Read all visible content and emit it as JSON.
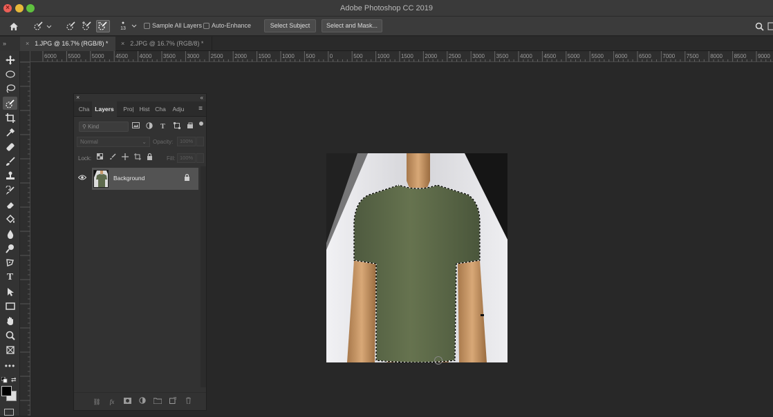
{
  "window": {
    "title": "Adobe Photoshop CC 2019",
    "close_glyph": "×"
  },
  "options_bar": {
    "brush_size": "13",
    "sample_all_layers": "Sample All Layers",
    "auto_enhance": "Auto-Enhance",
    "select_subject": "Select Subject",
    "select_and_mask": "Select and Mask..."
  },
  "document_tabs": [
    {
      "label": "1.JPG @ 16.7% (RGB/8) *",
      "active": true
    },
    {
      "label": "2.JPG @ 16.7% (RGB/8) *",
      "active": false
    }
  ],
  "ruler_labels": [
    "6000",
    "5500",
    "5000",
    "4500",
    "4000",
    "3500",
    "3000",
    "2500",
    "2000",
    "1500",
    "1000",
    "500",
    "0",
    "500",
    "1000",
    "1500",
    "2000",
    "2500",
    "3000",
    "3500",
    "4000",
    "4500",
    "5000",
    "5500",
    "6000",
    "6500",
    "7000",
    "7500",
    "8000",
    "8500",
    "9000"
  ],
  "layers_panel": {
    "tabs": [
      "Cha",
      "Layers",
      "Pro|",
      "Hist",
      "Cha",
      "Adju"
    ],
    "kind_placeholder": "Kind",
    "blend_mode": "Normal",
    "opacity_label": "Opacity:",
    "opacity_value": "100%",
    "lock_label": "Lock:",
    "fill_label": "Fill:",
    "fill_value": "100%",
    "layer_name": "Background"
  },
  "colors": {
    "shirt": "#5e6b4d",
    "background": "#282828",
    "panel": "#323232"
  },
  "icons": [
    "home-icon",
    "quick-selection-icon",
    "move-icon",
    "marquee-icon",
    "lasso-icon",
    "crop-icon",
    "eyedropper-icon",
    "healing-brush-icon",
    "brush-icon",
    "stamp-icon",
    "history-brush-icon",
    "eraser-icon",
    "paint-bucket-icon",
    "blur-icon",
    "dodge-icon",
    "pen-icon",
    "type-icon",
    "path-selection-icon",
    "rectangle-icon",
    "hand-icon",
    "zoom-icon",
    "search-icon",
    "eye-icon",
    "lock-icon"
  ]
}
